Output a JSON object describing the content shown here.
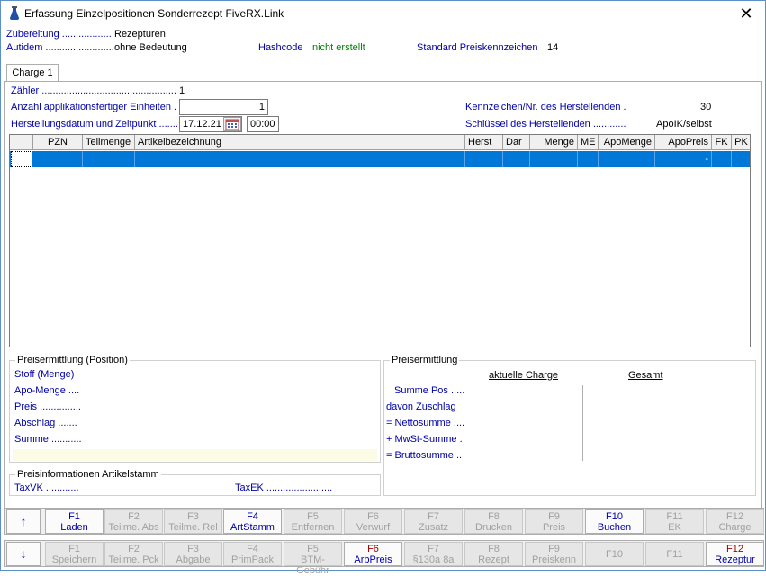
{
  "window": {
    "title": "Erfassung Einzelpositionen Sonderrezept FiveRX.Link",
    "close": "✕"
  },
  "header": {
    "zubereitung_label": "Zubereitung ..................",
    "zubereitung_value": "Rezepturen",
    "autidem_label": "Autidem .........................",
    "autidem_value": "ohne Bedeutung",
    "hashcode_label": "Hashcode",
    "hashcode_value": "nicht erstellt",
    "preiskenn_label": "Standard Preiskennzeichen",
    "preiskenn_value": "14"
  },
  "tab": {
    "label": "Charge 1"
  },
  "form": {
    "zaehler_label": "Zähler .................................................",
    "zaehler_value": "1",
    "anzahl_label": "Anzahl applikationsfertiger Einheiten .",
    "anzahl_value": "1",
    "datum_label": "Herstellungsdatum und Zeitpunkt .......",
    "datum_value": "17.12.21",
    "zeit_value": "00:00",
    "kennz_label": "Kennzeichen/Nr. des Herstellenden  .",
    "kennz_value": "30",
    "schluessel_label": "Schlüssel des Herstellenden ............",
    "schluessel_value": "ApoIK/selbst"
  },
  "grid": {
    "columns": [
      "",
      "PZN",
      "Teilmenge",
      "Artikelbezeichnung",
      "Herst",
      "Dar",
      "Menge",
      "ME",
      "ApoMenge",
      "ApoPreis",
      "FK",
      "PK"
    ],
    "row_apopreis": "-"
  },
  "preis_position": {
    "title": "Preisermittlung (Position)",
    "stoff": "Stoff (Menge)",
    "apomenge": "Apo-Menge ....",
    "preis": "Preis ...............",
    "abschlag": "Abschlag .......",
    "summe": "Summe ..........."
  },
  "preis_stamm": {
    "title": "Preisinformationen Artikelstamm",
    "taxvk": "TaxVK ............",
    "taxek": "TaxEK ........................"
  },
  "preis_total": {
    "title": "Preisermittlung",
    "col_charge": "aktuelle Charge",
    "col_gesamt": "Gesamt",
    "summe_pos": "Summe Pos .....",
    "zuschlag": "davon Zuschlag",
    "netto": "= Nettosumme ....",
    "mwst": "+ MwSt-Summe .",
    "brutto": "= Bruttosumme .."
  },
  "fbar1": {
    "arrow": "↑",
    "buttons": [
      {
        "key": "F1",
        "label": "Laden"
      },
      {
        "key": "F2",
        "label": "Teilme. Abs"
      },
      {
        "key": "F3",
        "label": "Teilme. Rel"
      },
      {
        "key": "F4",
        "label": "ArtStamm"
      },
      {
        "key": "F5",
        "label": "Entfernen"
      },
      {
        "key": "F6",
        "label": "Verwurf"
      },
      {
        "key": "F7",
        "label": "Zusatz"
      },
      {
        "key": "F8",
        "label": "Drucken"
      },
      {
        "key": "F9",
        "label": "Preis"
      },
      {
        "key": "F10",
        "label": "Buchen"
      },
      {
        "key": "F11",
        "label": "EK"
      },
      {
        "key": "F12",
        "label": "Charge"
      }
    ]
  },
  "fbar2": {
    "arrow": "↓",
    "buttons": [
      {
        "key": "F1",
        "label": "Speichern"
      },
      {
        "key": "F2",
        "label": "Teilme. Pck"
      },
      {
        "key": "F3",
        "label": "Abgabe"
      },
      {
        "key": "F4",
        "label": "PrimPack"
      },
      {
        "key": "F5",
        "label": "BTM-Gebühr"
      },
      {
        "key": "F6",
        "label": "ArbPreis"
      },
      {
        "key": "F7",
        "label": "§130a 8a"
      },
      {
        "key": "F8",
        "label": "Rezept"
      },
      {
        "key": "F9",
        "label": "Preiskenn"
      },
      {
        "key": "F10",
        "label": ""
      },
      {
        "key": "F11",
        "label": ""
      },
      {
        "key": "F12",
        "label": "Rezeptur"
      }
    ]
  }
}
